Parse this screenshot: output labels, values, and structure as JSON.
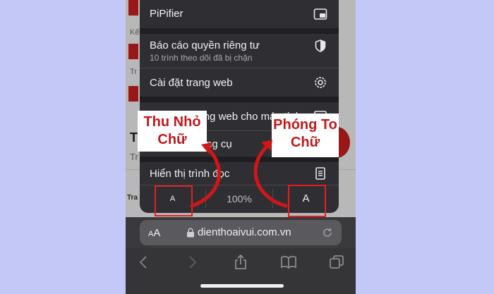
{
  "menu": {
    "items": [
      {
        "label": "PiPifier",
        "icon": "pip-icon"
      },
      {
        "label": "Báo cáo quyền riêng tư",
        "sublabel": "10 trình theo dõi đã bị chặn",
        "icon": "shield-icon"
      },
      {
        "label": "Cài đặt trang web",
        "icon": "gear-icon"
      },
      {
        "label": "Yêu cầu trang web cho máy tính",
        "icon": "desktop-icon"
      },
      {
        "label": "Ẩn thanh công cụ",
        "icon": "toolbar-icon"
      },
      {
        "label": "Hiển thị trình đọc",
        "icon": "reader-icon"
      }
    ],
    "zoom": {
      "decrease": "A",
      "percent": "100%",
      "increase": "A"
    }
  },
  "callouts": {
    "shrink": "Thu Nhỏ Chữ",
    "enlarge": "Phóng To Chữ"
  },
  "address_bar": {
    "aa": "AA",
    "url": "dienthoaivui.com.vn"
  },
  "background": {
    "snippet1": "Kế",
    "snippet2": "Tr",
    "snippet3": "T",
    "snippet4": "Tr",
    "snippet5": "Tra"
  },
  "colors": {
    "accent": "#c2181a",
    "menu_bg": "#2f2f33"
  }
}
